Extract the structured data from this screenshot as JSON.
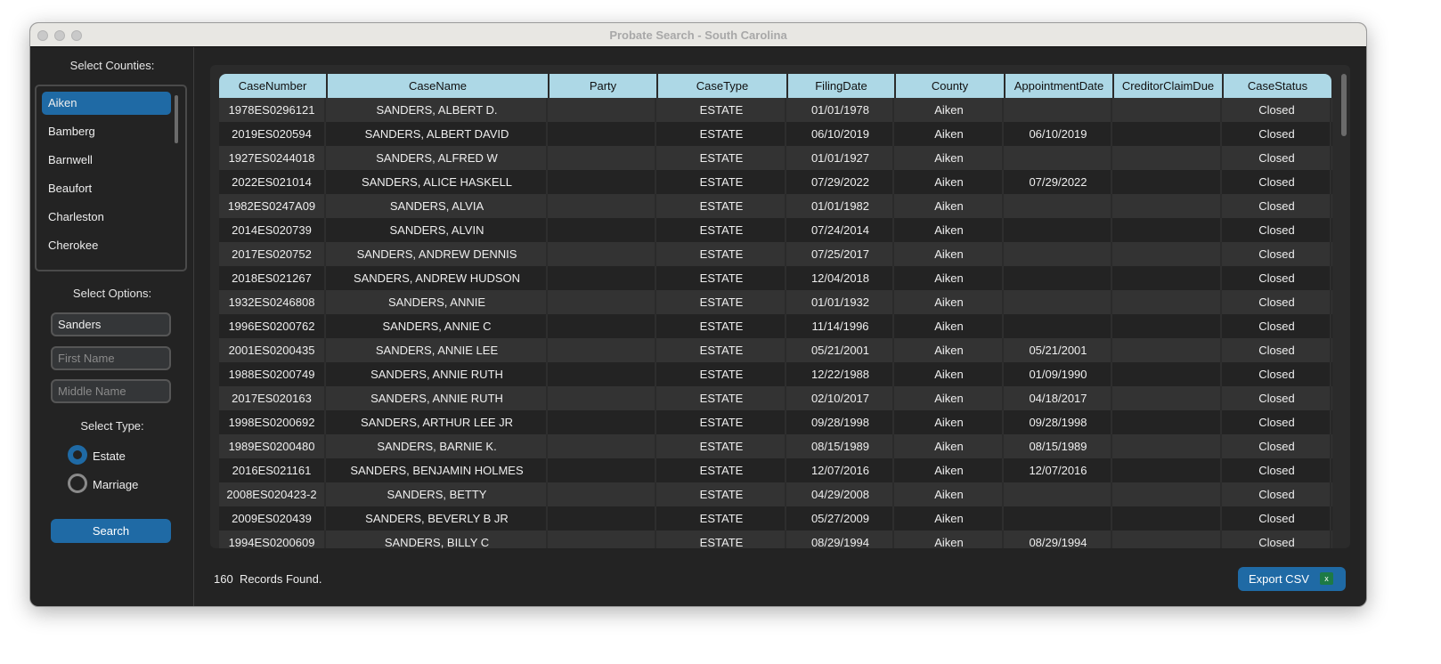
{
  "window": {
    "title": "Probate Search - South Carolina"
  },
  "sidebar": {
    "counties_label": "Select Counties:",
    "counties": [
      "Aiken",
      "Bamberg",
      "Barnwell",
      "Beaufort",
      "Charleston",
      "Cherokee"
    ],
    "options_label": "Select Options:",
    "last_name_value": "Sanders",
    "first_name_placeholder": "First Name",
    "middle_name_placeholder": "Middle Name",
    "type_label": "Select Type:",
    "types": [
      {
        "label": "Estate",
        "selected": true
      },
      {
        "label": "Marriage",
        "selected": false
      }
    ],
    "search_label": "Search"
  },
  "table": {
    "columns": [
      "CaseNumber",
      "CaseName",
      "Party",
      "CaseType",
      "FilingDate",
      "County",
      "AppointmentDate",
      "CreditorClaimDue",
      "CaseStatus"
    ],
    "rows": [
      [
        "1978ES0296121",
        "SANDERS, ALBERT D.",
        "",
        "ESTATE",
        "01/01/1978",
        "Aiken",
        "",
        "",
        "Closed"
      ],
      [
        "2019ES020594",
        "SANDERS, ALBERT DAVID",
        "",
        "ESTATE",
        "06/10/2019",
        "Aiken",
        "06/10/2019",
        "",
        "Closed"
      ],
      [
        "1927ES0244018",
        "SANDERS, ALFRED W",
        "",
        "ESTATE",
        "01/01/1927",
        "Aiken",
        "",
        "",
        "Closed"
      ],
      [
        "2022ES021014",
        "SANDERS, ALICE HASKELL",
        "",
        "ESTATE",
        "07/29/2022",
        "Aiken",
        "07/29/2022",
        "",
        "Closed"
      ],
      [
        "1982ES0247A09",
        "SANDERS, ALVIA",
        "",
        "ESTATE",
        "01/01/1982",
        "Aiken",
        "",
        "",
        "Closed"
      ],
      [
        "2014ES020739",
        "SANDERS, ALVIN",
        "",
        "ESTATE",
        "07/24/2014",
        "Aiken",
        "",
        "",
        "Closed"
      ],
      [
        "2017ES020752",
        "SANDERS, ANDREW DENNIS",
        "",
        "ESTATE",
        "07/25/2017",
        "Aiken",
        "",
        "",
        "Closed"
      ],
      [
        "2018ES021267",
        "SANDERS, ANDREW HUDSON",
        "",
        "ESTATE",
        "12/04/2018",
        "Aiken",
        "",
        "",
        "Closed"
      ],
      [
        "1932ES0246808",
        "SANDERS, ANNIE",
        "",
        "ESTATE",
        "01/01/1932",
        "Aiken",
        "",
        "",
        "Closed"
      ],
      [
        "1996ES0200762",
        "SANDERS, ANNIE C",
        "",
        "ESTATE",
        "11/14/1996",
        "Aiken",
        "",
        "",
        "Closed"
      ],
      [
        "2001ES0200435",
        "SANDERS, ANNIE LEE",
        "",
        "ESTATE",
        "05/21/2001",
        "Aiken",
        "05/21/2001",
        "",
        "Closed"
      ],
      [
        "1988ES0200749",
        "SANDERS, ANNIE RUTH",
        "",
        "ESTATE",
        "12/22/1988",
        "Aiken",
        "01/09/1990",
        "",
        "Closed"
      ],
      [
        "2017ES020163",
        "SANDERS, ANNIE RUTH",
        "",
        "ESTATE",
        "02/10/2017",
        "Aiken",
        "04/18/2017",
        "",
        "Closed"
      ],
      [
        "1998ES0200692",
        "SANDERS, ARTHUR LEE JR",
        "",
        "ESTATE",
        "09/28/1998",
        "Aiken",
        "09/28/1998",
        "",
        "Closed"
      ],
      [
        "1989ES0200480",
        "SANDERS, BARNIE K.",
        "",
        "ESTATE",
        "08/15/1989",
        "Aiken",
        "08/15/1989",
        "",
        "Closed"
      ],
      [
        "2016ES021161",
        "SANDERS, BENJAMIN HOLMES",
        "",
        "ESTATE",
        "12/07/2016",
        "Aiken",
        "12/07/2016",
        "",
        "Closed"
      ],
      [
        "2008ES020423-2",
        "SANDERS, BETTY",
        "",
        "ESTATE",
        "04/29/2008",
        "Aiken",
        "",
        "",
        "Closed"
      ],
      [
        "2009ES020439",
        "SANDERS, BEVERLY B JR",
        "",
        "ESTATE",
        "05/27/2009",
        "Aiken",
        "",
        "",
        "Closed"
      ],
      [
        "1994ES0200609",
        "SANDERS, BILLY C",
        "",
        "ESTATE",
        "08/29/1994",
        "Aiken",
        "08/29/1994",
        "",
        "Closed"
      ]
    ]
  },
  "footer": {
    "count": "160",
    "count_suffix": "Records Found.",
    "export_label": "Export CSV"
  },
  "colors": {
    "accent": "#1f6aa5",
    "header_bg": "#add8e6",
    "row_even": "#333333",
    "row_odd": "#232323"
  }
}
